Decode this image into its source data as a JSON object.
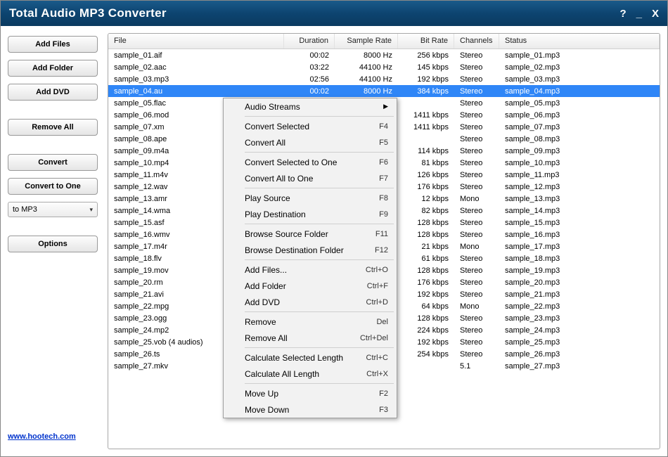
{
  "title": "Total Audio MP3 Converter",
  "titlebar_controls": {
    "help": "?",
    "minimize": "_",
    "close": "X"
  },
  "sidebar": {
    "add_files": "Add Files",
    "add_folder": "Add Folder",
    "add_dvd": "Add DVD",
    "remove_all": "Remove All",
    "convert": "Convert",
    "convert_to_one": "Convert to One",
    "format_selected": "to MP3",
    "options": "Options"
  },
  "footer_link": "www.hootech.com",
  "columns": {
    "file": "File",
    "duration": "Duration",
    "sample_rate": "Sample Rate",
    "bit_rate": "Bit Rate",
    "channels": "Channels",
    "status": "Status"
  },
  "rows": [
    {
      "file": "sample_01.aif",
      "duration": "00:02",
      "sample": "8000 Hz",
      "bitrate": "256 kbps",
      "channels": "Stereo",
      "status": "sample_01.mp3",
      "selected": false
    },
    {
      "file": "sample_02.aac",
      "duration": "03:22",
      "sample": "44100 Hz",
      "bitrate": "145 kbps",
      "channels": "Stereo",
      "status": "sample_02.mp3",
      "selected": false
    },
    {
      "file": "sample_03.mp3",
      "duration": "02:56",
      "sample": "44100 Hz",
      "bitrate": "192 kbps",
      "channels": "Stereo",
      "status": "sample_03.mp3",
      "selected": false
    },
    {
      "file": "sample_04.au",
      "duration": "00:02",
      "sample": "8000 Hz",
      "bitrate": "384 kbps",
      "channels": "Stereo",
      "status": "sample_04.mp3",
      "selected": true
    },
    {
      "file": "sample_05.flac",
      "duration": "",
      "sample": "",
      "bitrate": "",
      "channels": "Stereo",
      "status": "sample_05.mp3",
      "selected": false
    },
    {
      "file": "sample_06.mod",
      "duration": "",
      "sample": "",
      "bitrate": "1411 kbps",
      "channels": "Stereo",
      "status": "sample_06.mp3",
      "selected": false
    },
    {
      "file": "sample_07.xm",
      "duration": "",
      "sample": "",
      "bitrate": "1411 kbps",
      "channels": "Stereo",
      "status": "sample_07.mp3",
      "selected": false
    },
    {
      "file": "sample_08.ape",
      "duration": "",
      "sample": "",
      "bitrate": "",
      "channels": "Stereo",
      "status": "sample_08.mp3",
      "selected": false
    },
    {
      "file": "sample_09.m4a",
      "duration": "",
      "sample": "",
      "bitrate": "114 kbps",
      "channels": "Stereo",
      "status": "sample_09.mp3",
      "selected": false
    },
    {
      "file": "sample_10.mp4",
      "duration": "",
      "sample": "",
      "bitrate": "81 kbps",
      "channels": "Stereo",
      "status": "sample_10.mp3",
      "selected": false
    },
    {
      "file": "sample_11.m4v",
      "duration": "",
      "sample": "",
      "bitrate": "126 kbps",
      "channels": "Stereo",
      "status": "sample_11.mp3",
      "selected": false
    },
    {
      "file": "sample_12.wav",
      "duration": "",
      "sample": "",
      "bitrate": "176 kbps",
      "channels": "Stereo",
      "status": "sample_12.mp3",
      "selected": false
    },
    {
      "file": "sample_13.amr",
      "duration": "",
      "sample": "",
      "bitrate": "12 kbps",
      "channels": "Mono",
      "status": "sample_13.mp3",
      "selected": false
    },
    {
      "file": "sample_14.wma",
      "duration": "",
      "sample": "",
      "bitrate": "82 kbps",
      "channels": "Stereo",
      "status": "sample_14.mp3",
      "selected": false
    },
    {
      "file": "sample_15.asf",
      "duration": "",
      "sample": "",
      "bitrate": "128 kbps",
      "channels": "Stereo",
      "status": "sample_15.mp3",
      "selected": false
    },
    {
      "file": "sample_16.wmv",
      "duration": "",
      "sample": "",
      "bitrate": "128 kbps",
      "channels": "Stereo",
      "status": "sample_16.mp3",
      "selected": false
    },
    {
      "file": "sample_17.m4r",
      "duration": "",
      "sample": "",
      "bitrate": "21 kbps",
      "channels": "Mono",
      "status": "sample_17.mp3",
      "selected": false
    },
    {
      "file": "sample_18.flv",
      "duration": "",
      "sample": "",
      "bitrate": "61 kbps",
      "channels": "Stereo",
      "status": "sample_18.mp3",
      "selected": false
    },
    {
      "file": "sample_19.mov",
      "duration": "",
      "sample": "",
      "bitrate": "128 kbps",
      "channels": "Stereo",
      "status": "sample_19.mp3",
      "selected": false
    },
    {
      "file": "sample_20.rm",
      "duration": "",
      "sample": "",
      "bitrate": "176 kbps",
      "channels": "Stereo",
      "status": "sample_20.mp3",
      "selected": false
    },
    {
      "file": "sample_21.avi",
      "duration": "",
      "sample": "",
      "bitrate": "192 kbps",
      "channels": "Stereo",
      "status": "sample_21.mp3",
      "selected": false
    },
    {
      "file": "sample_22.mpg",
      "duration": "",
      "sample": "",
      "bitrate": "64 kbps",
      "channels": "Mono",
      "status": "sample_22.mp3",
      "selected": false
    },
    {
      "file": "sample_23.ogg",
      "duration": "",
      "sample": "",
      "bitrate": "128 kbps",
      "channels": "Stereo",
      "status": "sample_23.mp3",
      "selected": false
    },
    {
      "file": "sample_24.mp2",
      "duration": "",
      "sample": "",
      "bitrate": "224 kbps",
      "channels": "Stereo",
      "status": "sample_24.mp3",
      "selected": false
    },
    {
      "file": "sample_25.vob (4 audios)",
      "duration": "",
      "sample": "",
      "bitrate": "192 kbps",
      "channels": "Stereo",
      "status": "sample_25.mp3",
      "selected": false
    },
    {
      "file": "sample_26.ts",
      "duration": "",
      "sample": "",
      "bitrate": "254 kbps",
      "channels": "Stereo",
      "status": "sample_26.mp3",
      "selected": false
    },
    {
      "file": "sample_27.mkv",
      "duration": "",
      "sample": "",
      "bitrate": "",
      "channels": "5.1",
      "status": "sample_27.mp3",
      "selected": false
    }
  ],
  "context_menu": [
    {
      "type": "item",
      "label": "Audio Streams",
      "arrow": true
    },
    {
      "type": "sep"
    },
    {
      "type": "item",
      "label": "Convert Selected",
      "key": "F4"
    },
    {
      "type": "item",
      "label": "Convert All",
      "key": "F5"
    },
    {
      "type": "sep"
    },
    {
      "type": "item",
      "label": "Convert Selected to One",
      "key": "F6"
    },
    {
      "type": "item",
      "label": "Convert All to One",
      "key": "F7"
    },
    {
      "type": "sep"
    },
    {
      "type": "item",
      "label": "Play Source",
      "key": "F8"
    },
    {
      "type": "item",
      "label": "Play Destination",
      "key": "F9"
    },
    {
      "type": "sep"
    },
    {
      "type": "item",
      "label": "Browse Source Folder",
      "key": "F11"
    },
    {
      "type": "item",
      "label": "Browse Destination Folder",
      "key": "F12"
    },
    {
      "type": "sep"
    },
    {
      "type": "item",
      "label": "Add Files...",
      "key": "Ctrl+O"
    },
    {
      "type": "item",
      "label": "Add Folder",
      "key": "Ctrl+F"
    },
    {
      "type": "item",
      "label": "Add DVD",
      "key": "Ctrl+D"
    },
    {
      "type": "sep"
    },
    {
      "type": "item",
      "label": "Remove",
      "key": "Del"
    },
    {
      "type": "item",
      "label": "Remove All",
      "key": "Ctrl+Del"
    },
    {
      "type": "sep"
    },
    {
      "type": "item",
      "label": "Calculate Selected Length",
      "key": "Ctrl+C"
    },
    {
      "type": "item",
      "label": "Calculate All Length",
      "key": "Ctrl+X"
    },
    {
      "type": "sep"
    },
    {
      "type": "item",
      "label": "Move Up",
      "key": "F2"
    },
    {
      "type": "item",
      "label": "Move Down",
      "key": "F3"
    }
  ]
}
